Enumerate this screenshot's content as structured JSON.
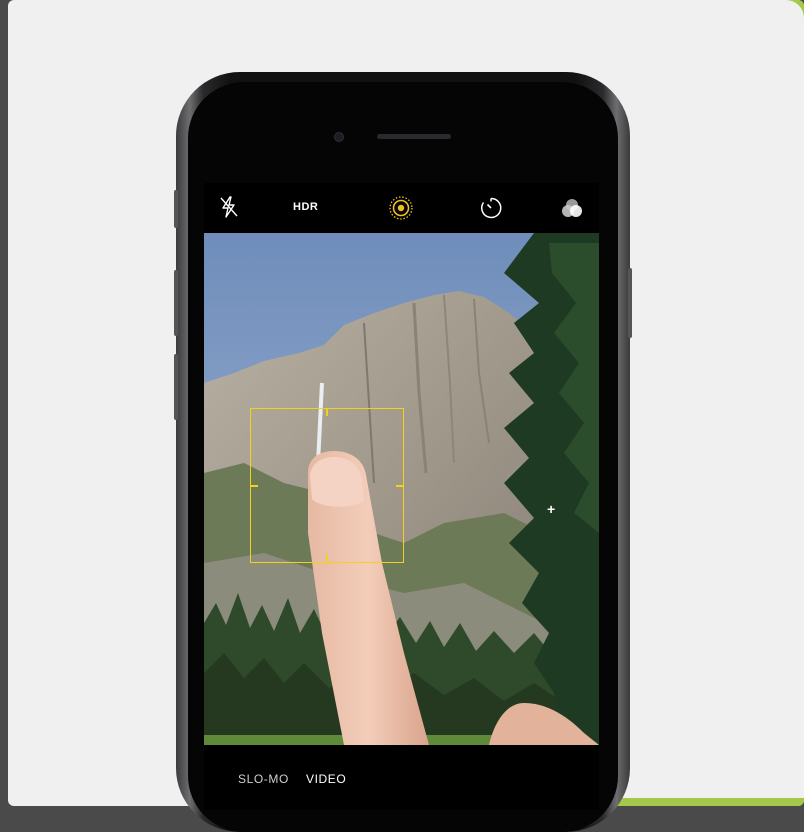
{
  "topbar": {
    "flash_icon": "flash-off-icon",
    "hdr_label": "HDR",
    "live_photo_icon": "live-photo-icon",
    "timer_icon": "timer-icon",
    "filters_icon": "filters-icon"
  },
  "modes": {
    "slomo_label": "SLO-MO",
    "video_label": "VIDEO"
  },
  "colors": {
    "accent_yellow": "#f2d21a",
    "brand_green": "#a3c94a"
  }
}
